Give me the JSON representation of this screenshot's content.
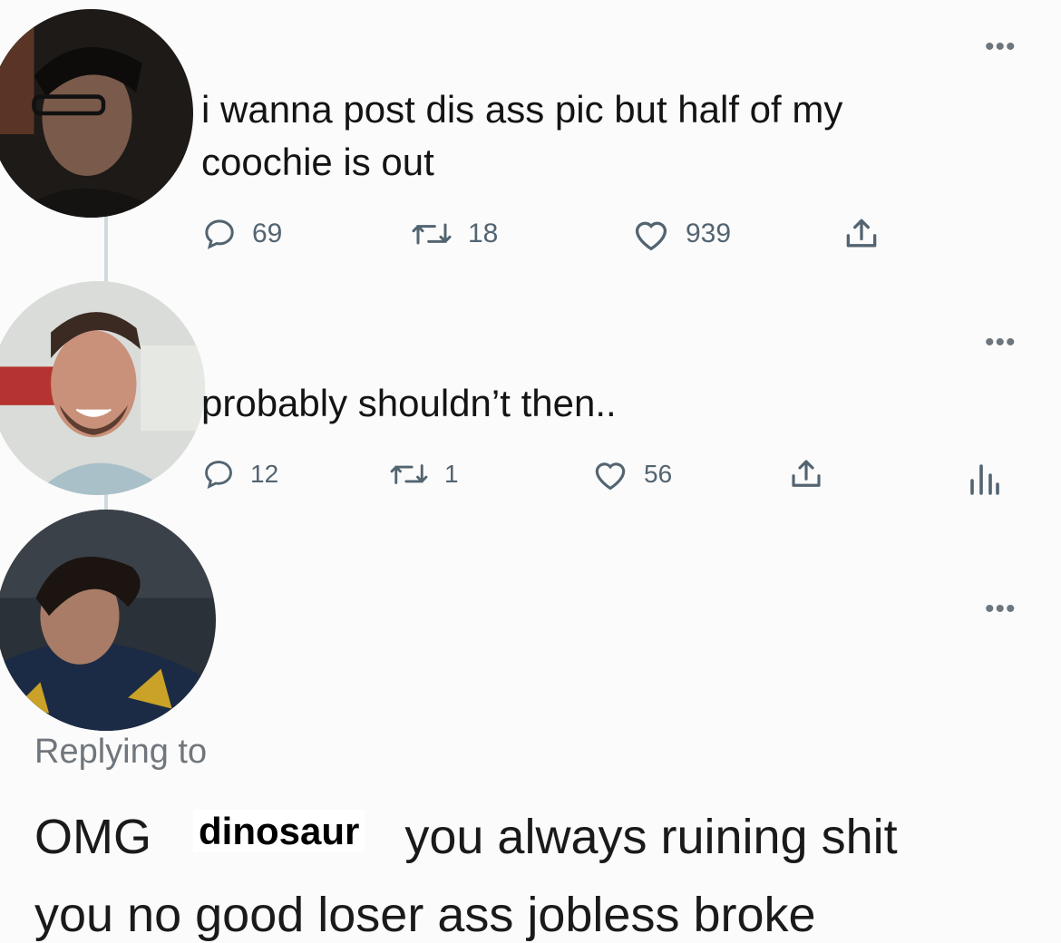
{
  "tweets": [
    {
      "text_lines": [
        "i wanna post dis ass pic but half of my",
        "coochie is out"
      ],
      "more_icon": "more-dots-icon",
      "replies": "69",
      "retweets": "18",
      "likes": "939"
    },
    {
      "text_lines": [
        "probably shouldn’t then.."
      ],
      "more_icon": "more-dots-icon",
      "replies": "12",
      "retweets": "1",
      "likes": "56"
    }
  ],
  "third": {
    "more_icon": "more-dots-icon"
  },
  "reply": {
    "replying_to": "Replying to",
    "prefix": "OMG",
    "sticker": "dinosaur",
    "suffix": "you always ruining shit",
    "cut_line": "you no good loser ass jobless broke"
  },
  "more_glyph": "•••",
  "colors": {
    "icon_gray": "#536471",
    "thread_line": "#cfd9de",
    "background": "#fbfbfb"
  }
}
